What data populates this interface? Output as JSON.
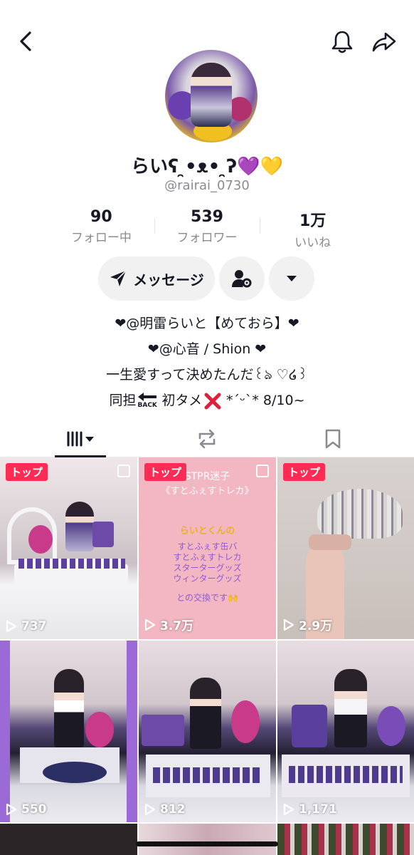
{
  "header": {
    "back_icon": "chevron-left-icon",
    "bell_icon": "bell-icon",
    "share_icon": "share-arrow-icon"
  },
  "profile": {
    "display_name": "らいʕ ̯•ᴥ• ̯ʔ💜💛",
    "username": "@rairai_0730"
  },
  "stats": [
    {
      "value": "90",
      "label": "フォロー中"
    },
    {
      "value": "539",
      "label": "フォロワー"
    },
    {
      "value": "1万",
      "label": "いいね"
    }
  ],
  "actions": {
    "message_label": "メッセージ"
  },
  "bio": {
    "line1": "❤@明雷らいと【めておら】❤",
    "line2": "❤@心音 / Shion ❤",
    "line3": "一生愛すって決めたんだ꒰ঌ ♡໒꒱",
    "line4_prefix": "同担",
    "line4_back": "BACK",
    "line4_mid": " 初タメ",
    "line4_suffix": " *ˊᵕˋ* 8/10~"
  },
  "tabs": {
    "videos_icon": "grid-icon",
    "reposts_icon": "repost-icon",
    "saved_icon": "bookmark-icon"
  },
  "videos": [
    {
      "badge": "トップ",
      "views": "737"
    },
    {
      "badge": "トップ",
      "views": "3.7万"
    },
    {
      "badge": "トップ",
      "views": "2.9万"
    },
    {
      "badge": "",
      "views": "550"
    },
    {
      "badge": "",
      "views": "812"
    },
    {
      "badge": "",
      "views": "1,171"
    }
  ],
  "pink_card": {
    "title1": "STPR迷子",
    "title2": "《すとふぇすトレカ》",
    "name": "らいとくんの",
    "item1": "すとふぇす缶バ",
    "item2": "すとふぇすトレカ",
    "item3": "スターターグッズ",
    "item4": "ウィンターグッズ",
    "closing": "との交換です🙌"
  },
  "colors": {
    "badge": "#fe2c55",
    "text": "#161823",
    "muted": "#8a8b91",
    "button_bg": "#f1f1f2"
  }
}
